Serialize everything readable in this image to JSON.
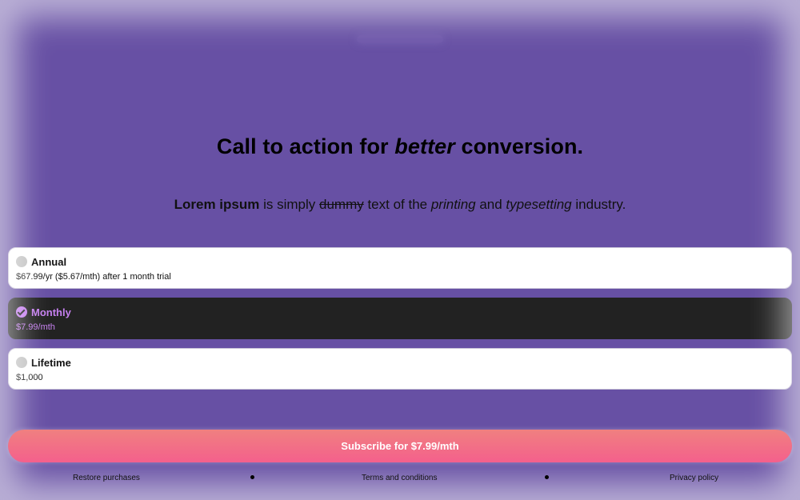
{
  "headline": {
    "part1": "Call to action for ",
    "emphasis": "better",
    "part2": " conversion."
  },
  "subtitle": {
    "bold": "Lorem ipsum",
    "t1": " is simply ",
    "strike": "dummy",
    "t2": " text of the ",
    "italic1": "printing",
    "t3": " and ",
    "italic2": "typesetting",
    "t4": " industry."
  },
  "plans": [
    {
      "title": "Annual",
      "price": "$67.99/yr ($5.67/mth) after 1 month trial",
      "selected": false
    },
    {
      "title": "Monthly",
      "price": "$7.99/mth",
      "selected": true
    },
    {
      "title": "Lifetime",
      "price": "$1,000",
      "selected": false
    }
  ],
  "subscribe_label": "Subscribe for $7.99/mth",
  "footer": {
    "restore": "Restore purchases",
    "terms": "Terms and conditions",
    "privacy": "Privacy policy"
  },
  "colors": {
    "background": "#6750a4",
    "selected_card": "#222222",
    "selected_accent": "#c680f0",
    "cta_gradient_top": "#f08080",
    "cta_gradient_bottom": "#f4608c"
  }
}
